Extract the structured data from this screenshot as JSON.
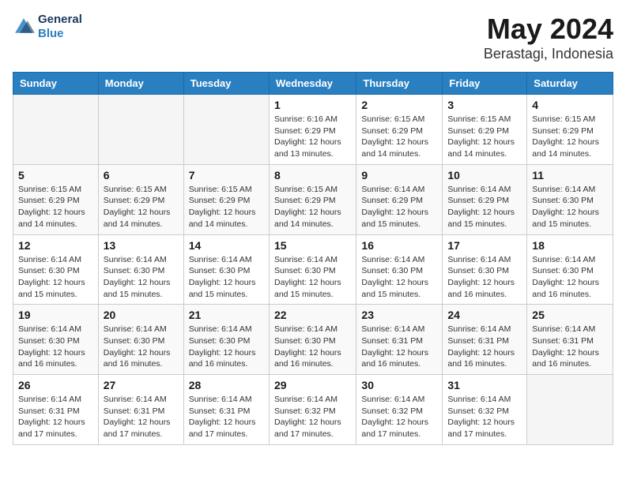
{
  "header": {
    "logo_line1": "General",
    "logo_line2": "Blue",
    "title": "May 2024",
    "subtitle": "Berastagi, Indonesia"
  },
  "days_of_week": [
    "Sunday",
    "Monday",
    "Tuesday",
    "Wednesday",
    "Thursday",
    "Friday",
    "Saturday"
  ],
  "weeks": [
    [
      {
        "day": "",
        "info": ""
      },
      {
        "day": "",
        "info": ""
      },
      {
        "day": "",
        "info": ""
      },
      {
        "day": "1",
        "info": "Sunrise: 6:16 AM\nSunset: 6:29 PM\nDaylight: 12 hours\nand 13 minutes."
      },
      {
        "day": "2",
        "info": "Sunrise: 6:15 AM\nSunset: 6:29 PM\nDaylight: 12 hours\nand 14 minutes."
      },
      {
        "day": "3",
        "info": "Sunrise: 6:15 AM\nSunset: 6:29 PM\nDaylight: 12 hours\nand 14 minutes."
      },
      {
        "day": "4",
        "info": "Sunrise: 6:15 AM\nSunset: 6:29 PM\nDaylight: 12 hours\nand 14 minutes."
      }
    ],
    [
      {
        "day": "5",
        "info": "Sunrise: 6:15 AM\nSunset: 6:29 PM\nDaylight: 12 hours\nand 14 minutes."
      },
      {
        "day": "6",
        "info": "Sunrise: 6:15 AM\nSunset: 6:29 PM\nDaylight: 12 hours\nand 14 minutes."
      },
      {
        "day": "7",
        "info": "Sunrise: 6:15 AM\nSunset: 6:29 PM\nDaylight: 12 hours\nand 14 minutes."
      },
      {
        "day": "8",
        "info": "Sunrise: 6:15 AM\nSunset: 6:29 PM\nDaylight: 12 hours\nand 14 minutes."
      },
      {
        "day": "9",
        "info": "Sunrise: 6:14 AM\nSunset: 6:29 PM\nDaylight: 12 hours\nand 15 minutes."
      },
      {
        "day": "10",
        "info": "Sunrise: 6:14 AM\nSunset: 6:29 PM\nDaylight: 12 hours\nand 15 minutes."
      },
      {
        "day": "11",
        "info": "Sunrise: 6:14 AM\nSunset: 6:30 PM\nDaylight: 12 hours\nand 15 minutes."
      }
    ],
    [
      {
        "day": "12",
        "info": "Sunrise: 6:14 AM\nSunset: 6:30 PM\nDaylight: 12 hours\nand 15 minutes."
      },
      {
        "day": "13",
        "info": "Sunrise: 6:14 AM\nSunset: 6:30 PM\nDaylight: 12 hours\nand 15 minutes."
      },
      {
        "day": "14",
        "info": "Sunrise: 6:14 AM\nSunset: 6:30 PM\nDaylight: 12 hours\nand 15 minutes."
      },
      {
        "day": "15",
        "info": "Sunrise: 6:14 AM\nSunset: 6:30 PM\nDaylight: 12 hours\nand 15 minutes."
      },
      {
        "day": "16",
        "info": "Sunrise: 6:14 AM\nSunset: 6:30 PM\nDaylight: 12 hours\nand 15 minutes."
      },
      {
        "day": "17",
        "info": "Sunrise: 6:14 AM\nSunset: 6:30 PM\nDaylight: 12 hours\nand 16 minutes."
      },
      {
        "day": "18",
        "info": "Sunrise: 6:14 AM\nSunset: 6:30 PM\nDaylight: 12 hours\nand 16 minutes."
      }
    ],
    [
      {
        "day": "19",
        "info": "Sunrise: 6:14 AM\nSunset: 6:30 PM\nDaylight: 12 hours\nand 16 minutes."
      },
      {
        "day": "20",
        "info": "Sunrise: 6:14 AM\nSunset: 6:30 PM\nDaylight: 12 hours\nand 16 minutes."
      },
      {
        "day": "21",
        "info": "Sunrise: 6:14 AM\nSunset: 6:30 PM\nDaylight: 12 hours\nand 16 minutes."
      },
      {
        "day": "22",
        "info": "Sunrise: 6:14 AM\nSunset: 6:30 PM\nDaylight: 12 hours\nand 16 minutes."
      },
      {
        "day": "23",
        "info": "Sunrise: 6:14 AM\nSunset: 6:31 PM\nDaylight: 12 hours\nand 16 minutes."
      },
      {
        "day": "24",
        "info": "Sunrise: 6:14 AM\nSunset: 6:31 PM\nDaylight: 12 hours\nand 16 minutes."
      },
      {
        "day": "25",
        "info": "Sunrise: 6:14 AM\nSunset: 6:31 PM\nDaylight: 12 hours\nand 16 minutes."
      }
    ],
    [
      {
        "day": "26",
        "info": "Sunrise: 6:14 AM\nSunset: 6:31 PM\nDaylight: 12 hours\nand 17 minutes."
      },
      {
        "day": "27",
        "info": "Sunrise: 6:14 AM\nSunset: 6:31 PM\nDaylight: 12 hours\nand 17 minutes."
      },
      {
        "day": "28",
        "info": "Sunrise: 6:14 AM\nSunset: 6:31 PM\nDaylight: 12 hours\nand 17 minutes."
      },
      {
        "day": "29",
        "info": "Sunrise: 6:14 AM\nSunset: 6:32 PM\nDaylight: 12 hours\nand 17 minutes."
      },
      {
        "day": "30",
        "info": "Sunrise: 6:14 AM\nSunset: 6:32 PM\nDaylight: 12 hours\nand 17 minutes."
      },
      {
        "day": "31",
        "info": "Sunrise: 6:14 AM\nSunset: 6:32 PM\nDaylight: 12 hours\nand 17 minutes."
      },
      {
        "day": "",
        "info": ""
      }
    ]
  ]
}
